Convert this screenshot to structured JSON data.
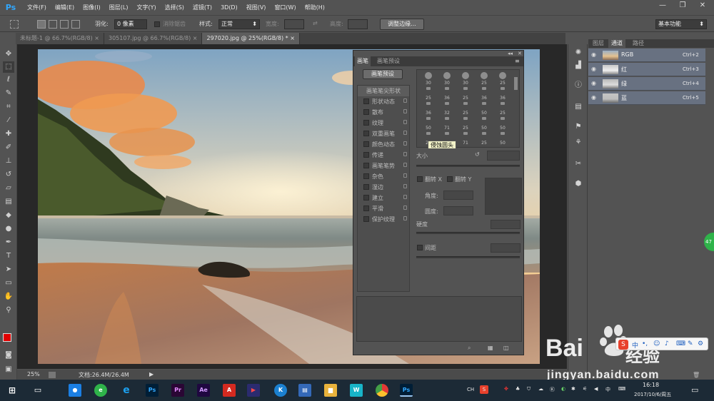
{
  "app": {
    "logo": "Ps"
  },
  "menu": [
    "文件(F)",
    "编辑(E)",
    "图像(I)",
    "图层(L)",
    "文字(Y)",
    "选择(S)",
    "滤镜(T)",
    "3D(D)",
    "视图(V)",
    "窗口(W)",
    "帮助(H)"
  ],
  "window_controls": {
    "minimize": "—",
    "restore": "❐",
    "close": "✕"
  },
  "options": {
    "feather_label": "羽化:",
    "feather_value": "0 像素",
    "antialias_label": "消除锯齿",
    "style_label": "样式:",
    "style_value": "正常",
    "width_label": "宽度:",
    "height_label": "高度:",
    "refine_button": "调整边缘...",
    "workspace": "基本功能"
  },
  "tabs": [
    {
      "label": "未标题-1 @ 66.7%(RGB/8)",
      "close": "×"
    },
    {
      "label": "305107.jpg @ 66.7%(RGB/8)",
      "close": "×"
    },
    {
      "label": "297020.jpg @ 25%(RGB/8) *",
      "close": "×"
    }
  ],
  "status": {
    "zoom": "25%",
    "doc": "文档:26.4M/26.4M"
  },
  "brush_panel": {
    "tabs": [
      "画笔",
      "画笔预设"
    ],
    "preset_button": "画笔预设",
    "tip_shape_header": "画笔笔尖形状",
    "options": [
      "形状动态",
      "散布",
      "纹理",
      "双重画笔",
      "颜色动态",
      "传递",
      "画笔笔势",
      "杂色",
      "湿边",
      "建立",
      "平滑",
      "保护纹理"
    ],
    "tip_sizes": [
      30,
      30,
      30,
      25,
      25,
      25,
      36,
      25,
      36,
      36,
      36,
      32,
      25,
      50,
      25,
      50,
      71,
      25,
      50,
      50,
      25,
      50,
      71,
      25,
      50
    ],
    "tooltip": "侵蚀圆头",
    "size_label": "大小",
    "flip_x": "翻转 X",
    "flip_y": "翻转 Y",
    "angle_label": "角度:",
    "roundness_label": "圆度:",
    "hardness_label": "硬度",
    "spacing_label": "间距"
  },
  "channels": {
    "tabs": [
      "图层",
      "通道",
      "路径"
    ],
    "rows": [
      {
        "name": "RGB",
        "shortcut": "Ctrl+2"
      },
      {
        "name": "红",
        "shortcut": "Ctrl+3"
      },
      {
        "name": "绿",
        "shortcut": "Ctrl+4"
      },
      {
        "name": "蓝",
        "shortcut": "Ctrl+5"
      }
    ]
  },
  "taskbar": {
    "ime": "CH",
    "time": "16:18",
    "date": "2017/10/6/周五"
  },
  "watermark": {
    "brand": "Bai",
    "brand2": "经验",
    "url": "jingyan.baidu.com"
  },
  "side_badge": "47",
  "colors": {
    "accent": "#31a8ff",
    "ui_bg": "#535353",
    "channel_sel": "#687181",
    "taskbar": "#1c2a36"
  }
}
